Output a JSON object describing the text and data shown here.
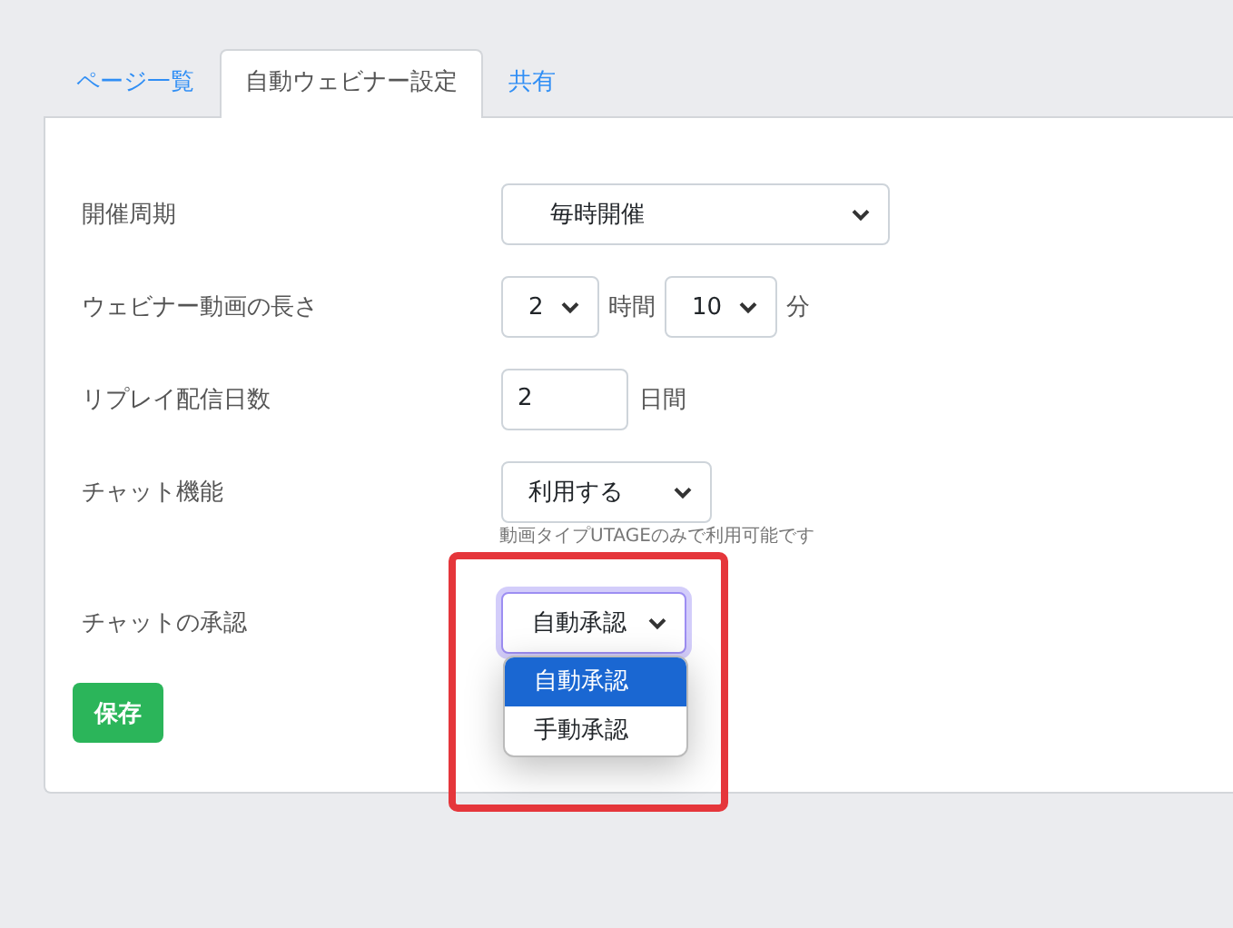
{
  "tabs": [
    {
      "label": "ページ一覧",
      "selected": false
    },
    {
      "label": "自動ウェビナー設定",
      "selected": true
    },
    {
      "label": "共有",
      "selected": false
    }
  ],
  "rows": [
    {
      "kind": "select",
      "label": "開催周期",
      "value": "毎時開催"
    },
    {
      "kind": "duration",
      "label": "ウェビナー動画の長さ",
      "hours": "2",
      "hours_unit": "時間",
      "minutes": "10",
      "minutes_unit": "分"
    },
    {
      "kind": "number",
      "label": "リプレイ配信日数",
      "value": "2",
      "unit": "日間"
    },
    {
      "kind": "select",
      "label": "チャット機能",
      "value": "利用する",
      "hint": "動画タイプUTAGEのみで利用可能です"
    },
    {
      "kind": "open-select",
      "label": "チャットの承認",
      "value": "自動承認",
      "options": [
        {
          "label": "自動承認",
          "selected": true
        },
        {
          "label": "手動承認",
          "selected": false
        }
      ]
    }
  ],
  "save_button": "保存",
  "annotation": {
    "kind": "highlight-box",
    "color": "#e5363b"
  }
}
